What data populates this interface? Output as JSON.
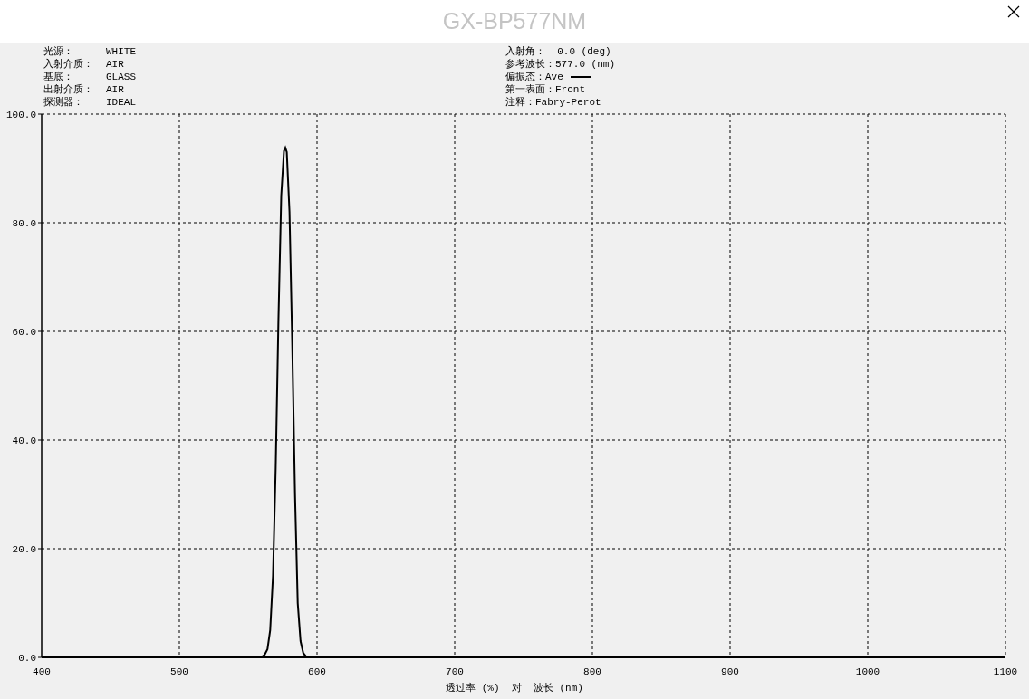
{
  "window": {
    "title": "GX-BP577NM"
  },
  "info_left": [
    {
      "label": "光源：",
      "value": "WHITE"
    },
    {
      "label": "入射介质：",
      "value": "AIR"
    },
    {
      "label": "基底：",
      "value": "GLASS"
    },
    {
      "label": "出射介质：",
      "value": "AIR"
    },
    {
      "label": "探测器：",
      "value": "IDEAL"
    }
  ],
  "info_right": [
    {
      "label": "入射角：",
      "value": "  0.0 (deg)"
    },
    {
      "label": "参考波长：",
      "value": "577.0 (nm)"
    },
    {
      "label": "偏振态：",
      "kind": "legend"
    },
    {
      "label": "第一表面：",
      "value": "Front"
    },
    {
      "label": "注释：",
      "value": "Fabry-Perot"
    }
  ],
  "chart_data": {
    "type": "line",
    "grid": true,
    "xlabel": "透过率 (%)  对  波长 (nm)",
    "xlim": [
      400,
      1100
    ],
    "ylim": [
      0,
      100
    ],
    "xticks": [
      400,
      500,
      600,
      700,
      800,
      900,
      1000,
      1100
    ],
    "yticks": [
      {
        "value": 0,
        "label": "0.0"
      },
      {
        "value": 20,
        "label": "20.0"
      },
      {
        "value": 40,
        "label": "40.0"
      },
      {
        "value": 60,
        "label": "60.0"
      },
      {
        "value": 80,
        "label": "80.0"
      },
      {
        "value": 100,
        "label": "100.0"
      }
    ],
    "x": [
      400,
      558,
      560,
      562,
      564,
      566,
      568,
      570,
      572,
      574,
      576,
      577,
      578,
      580,
      582,
      584,
      586,
      588,
      590,
      592,
      594,
      1100
    ],
    "series": [
      {
        "name": "Ave",
        "color": "#000000",
        "values": [
          0,
          0,
          0.1,
          0.5,
          1.5,
          5,
          15,
          35,
          62,
          85,
          93.2,
          93.8,
          93,
          82,
          58,
          30,
          10,
          3,
          0.8,
          0.2,
          0,
          0
        ]
      }
    ]
  }
}
